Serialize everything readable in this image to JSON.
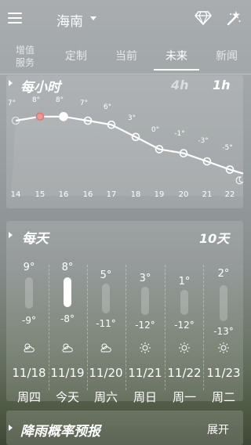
{
  "header": {
    "city": "海南",
    "menu_icon": "menu-icon",
    "caret_icon": "chevron-down-icon",
    "diamond_icon": "diamond-icon",
    "magic_icon": "magic-wand-icon"
  },
  "tabs": [
    {
      "label": "增值服务",
      "active": false
    },
    {
      "label": "定制",
      "active": false
    },
    {
      "label": "当前",
      "active": false
    },
    {
      "label": "未来",
      "active": true
    },
    {
      "label": "新闻",
      "active": false
    }
  ],
  "hourly": {
    "title": "每小时",
    "toggle_4h": "4h",
    "toggle_1h": "1h",
    "temps": [
      "7°",
      "8°",
      "8°",
      "7°",
      "6°",
      "3°",
      "0°",
      "-1°",
      "-3°",
      "-5°"
    ],
    "temp_values": [
      7,
      8,
      8,
      7,
      6,
      3,
      0,
      -1,
      -3,
      -5,
      -6
    ],
    "hours": [
      "14",
      "15",
      "16",
      "16",
      "17",
      "18",
      "19",
      "20",
      "21",
      "22"
    ]
  },
  "daily": {
    "title": "每天",
    "range_label": "10天",
    "days": [
      {
        "high": "9°",
        "low": "-9°",
        "date": "11/18",
        "name": "周四",
        "icon": "partly-cloudy-icon",
        "fill": 0.0
      },
      {
        "high": "8°",
        "low": "-8°",
        "date": "11/19",
        "name": "今天",
        "icon": "partly-cloudy-icon",
        "fill": 1.0
      },
      {
        "high": "5°",
        "low": "-11°",
        "date": "11/20",
        "name": "周六",
        "icon": "partly-cloudy-icon",
        "fill": 0.0
      },
      {
        "high": "3°",
        "low": "-12°",
        "date": "11/21",
        "name": "周日",
        "icon": "sunny-icon",
        "fill": 0.0
      },
      {
        "high": "1°",
        "low": "-12°",
        "date": "11/22",
        "name": "周一",
        "icon": "sunny-icon",
        "fill": 0.0
      },
      {
        "high": "2°",
        "low": "-13°",
        "date": "11/23",
        "name": "周二",
        "icon": "sunny-icon",
        "fill": 0.0
      }
    ]
  },
  "rain": {
    "title": "降雨概率预报",
    "expand_label": "展开"
  }
}
